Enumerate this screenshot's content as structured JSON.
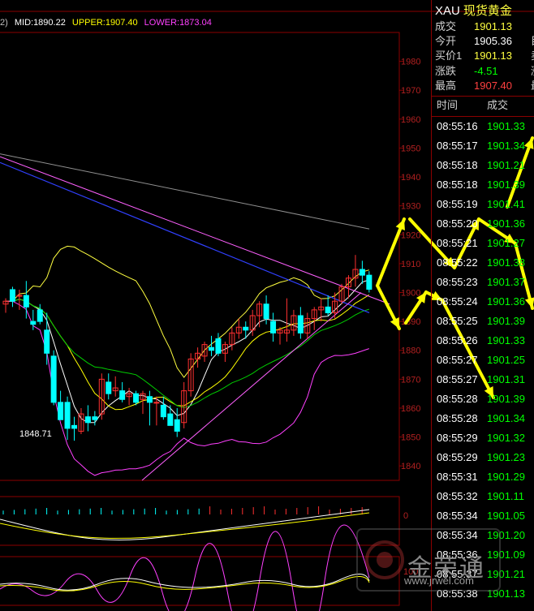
{
  "header": {
    "prefix": "2)",
    "mid_label": "MID:1890.22",
    "upper_label": "UPPER:1907.40",
    "lower_label": "LOWER:1873.04",
    "colors": {
      "mid": "#ffffff",
      "upper": "#ffff00",
      "lower": "#ff40ff"
    }
  },
  "panel": {
    "symbol": "XAU",
    "name": "现货黄金",
    "info": [
      {
        "label": "成交",
        "value": "1901.13",
        "color": "#ffff40",
        "extra": ""
      },
      {
        "label": "今开",
        "value": "1905.36",
        "color": "#ffffff",
        "extra": "目"
      },
      {
        "label": "买价1",
        "value": "1901.13",
        "color": "#ffff40",
        "extra": "卖"
      },
      {
        "label": "涨跌",
        "value": "-4.51",
        "color": "#00ff00",
        "extra": "涨"
      },
      {
        "label": "最高",
        "value": "1907.40",
        "color": "#ff4040",
        "extra": "最"
      }
    ],
    "trade_header": {
      "time": "时间",
      "price": "成交"
    },
    "trades": [
      {
        "time": "08:55:16",
        "price": "1901.33"
      },
      {
        "time": "08:55:17",
        "price": "1901.34"
      },
      {
        "time": "08:55:18",
        "price": "1901.21"
      },
      {
        "time": "08:55:18",
        "price": "1901.39"
      },
      {
        "time": "08:55:19",
        "price": "1901.41"
      },
      {
        "time": "08:55:20",
        "price": "1901.36"
      },
      {
        "time": "08:55:21",
        "price": "1901.27"
      },
      {
        "time": "08:55:22",
        "price": "1901.38"
      },
      {
        "time": "08:55:23",
        "price": "1901.37"
      },
      {
        "time": "08:55:24",
        "price": "1901.36"
      },
      {
        "time": "08:55:25",
        "price": "1901.39"
      },
      {
        "time": "08:55:26",
        "price": "1901.33"
      },
      {
        "time": "08:55:27",
        "price": "1901.25"
      },
      {
        "time": "08:55:27",
        "price": "1901.31"
      },
      {
        "time": "08:55:28",
        "price": "1901.39"
      },
      {
        "time": "08:55:28",
        "price": "1901.34"
      },
      {
        "time": "08:55:29",
        "price": "1901.32"
      },
      {
        "time": "08:55:29",
        "price": "1901.23"
      },
      {
        "time": "08:55:31",
        "price": "1901.29"
      },
      {
        "time": "08:55:32",
        "price": "1901.11"
      },
      {
        "time": "08:55:34",
        "price": "1901.05"
      },
      {
        "time": "08:55:34",
        "price": "1901.20"
      },
      {
        "time": "08:55:36",
        "price": "1901.09"
      },
      {
        "time": "08:55:37",
        "price": "1901.21"
      },
      {
        "time": "08:55:38",
        "price": "1901.13"
      }
    ]
  },
  "watermark": {
    "text": "金荣通",
    "url": "www.jrwel.com"
  },
  "chart_data": {
    "type": "candlestick",
    "ylim": [
      1835,
      1990
    ],
    "yticks": [
      1840,
      1850,
      1860,
      1870,
      1880,
      1890,
      1900,
      1910,
      1920,
      1930,
      1940,
      1950,
      1960,
      1970,
      1980
    ],
    "annotation": {
      "text": "1848.71",
      "value": 1848.71
    },
    "candles": [
      {
        "o": 1896,
        "h": 1898,
        "l": 1893,
        "c": 1897
      },
      {
        "o": 1901,
        "h": 1902,
        "l": 1895,
        "c": 1897
      },
      {
        "o": 1899,
        "h": 1901,
        "l": 1894,
        "c": 1899
      },
      {
        "o": 1899,
        "h": 1904,
        "l": 1891,
        "c": 1895
      },
      {
        "o": 1890,
        "h": 1894,
        "l": 1887,
        "c": 1889
      },
      {
        "o": 1894,
        "h": 1896,
        "l": 1889,
        "c": 1890
      },
      {
        "o": 1887,
        "h": 1893,
        "l": 1875,
        "c": 1879
      },
      {
        "o": 1878,
        "h": 1880,
        "l": 1861,
        "c": 1862
      },
      {
        "o": 1862,
        "h": 1866,
        "l": 1856,
        "c": 1856
      },
      {
        "o": 1862,
        "h": 1864,
        "l": 1849,
        "c": 1853
      },
      {
        "o": 1854,
        "h": 1857,
        "l": 1848.71,
        "c": 1853
      },
      {
        "o": 1852,
        "h": 1860,
        "l": 1851,
        "c": 1858
      },
      {
        "o": 1857,
        "h": 1861,
        "l": 1852,
        "c": 1855
      },
      {
        "o": 1857,
        "h": 1859,
        "l": 1854,
        "c": 1856
      },
      {
        "o": 1858,
        "h": 1872,
        "l": 1856,
        "c": 1870
      },
      {
        "o": 1869,
        "h": 1872,
        "l": 1863,
        "c": 1865
      },
      {
        "o": 1866,
        "h": 1871,
        "l": 1864,
        "c": 1867
      },
      {
        "o": 1866,
        "h": 1869,
        "l": 1862,
        "c": 1863
      },
      {
        "o": 1864,
        "h": 1867,
        "l": 1861,
        "c": 1865
      },
      {
        "o": 1865,
        "h": 1866,
        "l": 1861,
        "c": 1862
      },
      {
        "o": 1863,
        "h": 1866,
        "l": 1858,
        "c": 1865
      },
      {
        "o": 1864,
        "h": 1866,
        "l": 1854,
        "c": 1862
      },
      {
        "o": 1862,
        "h": 1864,
        "l": 1854,
        "c": 1862
      },
      {
        "o": 1861,
        "h": 1864,
        "l": 1856,
        "c": 1857
      },
      {
        "o": 1858,
        "h": 1861,
        "l": 1854,
        "c": 1854
      },
      {
        "o": 1856,
        "h": 1860,
        "l": 1850,
        "c": 1852
      },
      {
        "o": 1855,
        "h": 1869,
        "l": 1853,
        "c": 1866
      },
      {
        "o": 1866,
        "h": 1879,
        "l": 1864,
        "c": 1877
      },
      {
        "o": 1877,
        "h": 1881,
        "l": 1874,
        "c": 1879
      },
      {
        "o": 1878,
        "h": 1883,
        "l": 1876,
        "c": 1882
      },
      {
        "o": 1881,
        "h": 1885,
        "l": 1878,
        "c": 1880
      },
      {
        "o": 1884,
        "h": 1886,
        "l": 1878,
        "c": 1879
      },
      {
        "o": 1879,
        "h": 1883,
        "l": 1876,
        "c": 1882
      },
      {
        "o": 1882,
        "h": 1888,
        "l": 1880,
        "c": 1886
      },
      {
        "o": 1886,
        "h": 1891,
        "l": 1884,
        "c": 1888
      },
      {
        "o": 1888,
        "h": 1890,
        "l": 1884,
        "c": 1887
      },
      {
        "o": 1887,
        "h": 1894,
        "l": 1885,
        "c": 1892
      },
      {
        "o": 1892,
        "h": 1897,
        "l": 1888,
        "c": 1896
      },
      {
        "o": 1896,
        "h": 1899,
        "l": 1889,
        "c": 1891
      },
      {
        "o": 1890,
        "h": 1893,
        "l": 1883,
        "c": 1886
      },
      {
        "o": 1886,
        "h": 1888,
        "l": 1882,
        "c": 1887
      },
      {
        "o": 1886,
        "h": 1898,
        "l": 1883,
        "c": 1887
      },
      {
        "o": 1887,
        "h": 1894,
        "l": 1885,
        "c": 1892
      },
      {
        "o": 1892,
        "h": 1895,
        "l": 1884,
        "c": 1886
      },
      {
        "o": 1886,
        "h": 1893,
        "l": 1884,
        "c": 1891
      },
      {
        "o": 1891,
        "h": 1895,
        "l": 1887,
        "c": 1894
      },
      {
        "o": 1894,
        "h": 1898,
        "l": 1890,
        "c": 1895
      },
      {
        "o": 1895,
        "h": 1899,
        "l": 1892,
        "c": 1893
      },
      {
        "o": 1893,
        "h": 1900,
        "l": 1891,
        "c": 1897
      },
      {
        "o": 1897,
        "h": 1903,
        "l": 1896,
        "c": 1902
      },
      {
        "o": 1902,
        "h": 1906,
        "l": 1898,
        "c": 1905
      },
      {
        "o": 1905,
        "h": 1913,
        "l": 1902,
        "c": 1908
      },
      {
        "o": 1908,
        "h": 1911,
        "l": 1903,
        "c": 1906
      },
      {
        "o": 1906,
        "h": 1907.4,
        "l": 1900,
        "c": 1901.13
      }
    ]
  }
}
